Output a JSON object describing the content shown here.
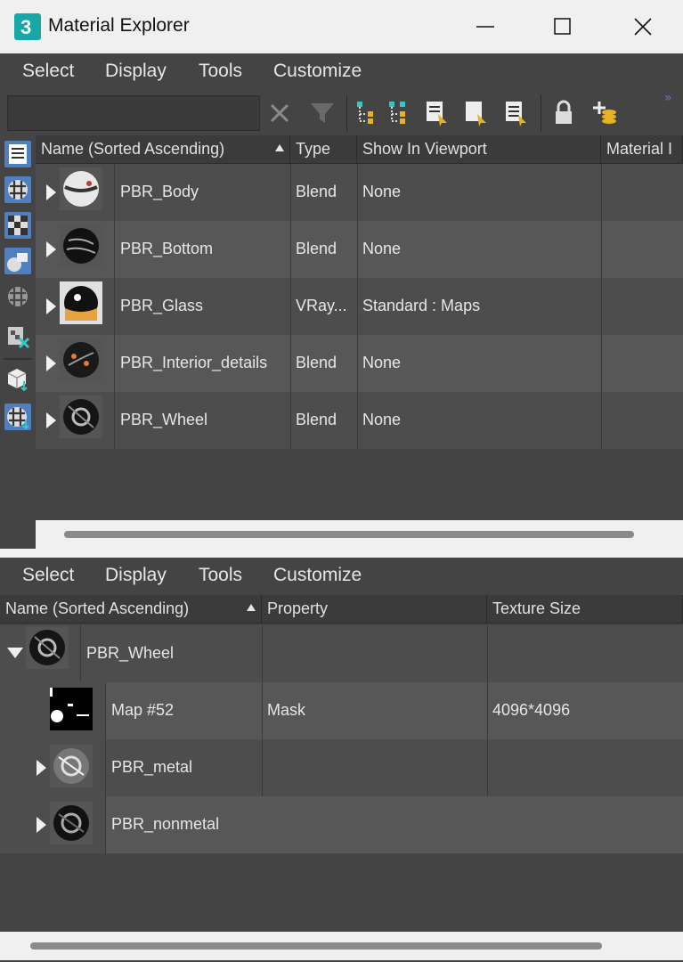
{
  "window": {
    "title": "Material Explorer",
    "app_icon": "3dsmax-icon"
  },
  "top_menu": [
    "Select",
    "Display",
    "Tools",
    "Customize"
  ],
  "toolbar": {
    "search_value": "",
    "icons": [
      "close-filter-icon",
      "funnel-icon",
      "hierarchy-expand-icon",
      "hierarchy-collapse-icon",
      "document-select-icon",
      "page-select-icon",
      "document-list-icon",
      "lock-icon",
      "add-layers-icon"
    ]
  },
  "left_strip": {
    "icons": [
      "list-view-icon",
      "material-sphere-icon",
      "checker-map-icon",
      "scene-objects-icon",
      "checker-fade-icon",
      "missing-map-icon",
      "box-down-icon",
      "sphere-down-icon"
    ]
  },
  "upper": {
    "headers": [
      "Name (Sorted Ascending)",
      "Type",
      "Show In Viewport",
      "Material I"
    ],
    "rows": [
      {
        "name": "PBR_Body",
        "type": "Blend",
        "viewport": "None"
      },
      {
        "name": "PBR_Bottom",
        "type": "Blend",
        "viewport": "None"
      },
      {
        "name": "PBR_Glass",
        "type": "VRay...",
        "viewport": "Standard : Maps"
      },
      {
        "name": "PBR_Interior_details",
        "type": "Blend",
        "viewport": "None"
      },
      {
        "name": "PBR_Wheel",
        "type": "Blend",
        "viewport": "None"
      }
    ]
  },
  "bottom_menu": [
    "Select",
    "Display",
    "Tools",
    "Customize"
  ],
  "lower": {
    "headers": [
      "Name (Sorted Ascending)",
      "Property",
      "Texture Size"
    ],
    "rows": [
      {
        "name": "PBR_Wheel",
        "property": "",
        "size": ""
      },
      {
        "name": "Map #52",
        "property": "Mask",
        "size": "4096*4096"
      },
      {
        "name": "PBR_metal",
        "property": "",
        "size": ""
      },
      {
        "name": "PBR_nonmetal",
        "property": "",
        "size": ""
      }
    ]
  },
  "colors": {
    "panel": "#444444",
    "row_odd": "#4d4d4d",
    "row_even": "#575757",
    "accent": "#4f7fbf",
    "icon_gold": "#e6b422",
    "icon_teal": "#35c6c6"
  }
}
